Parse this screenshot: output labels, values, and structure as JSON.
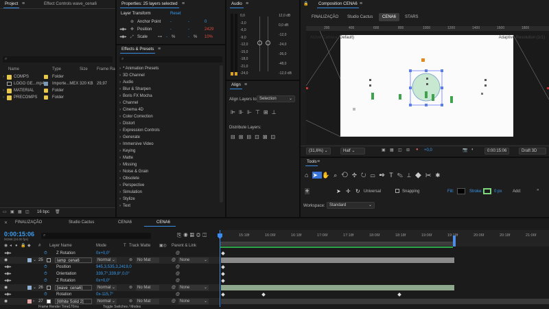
{
  "project": {
    "tabs": [
      "Project",
      "Effect Controls wave_cena6"
    ],
    "search_placeholder": "",
    "columns": [
      "Name",
      "Type",
      "Size",
      "Frame Ra..."
    ],
    "items": [
      {
        "name": "COMPS",
        "type": "Folder",
        "size": "",
        "fps": "",
        "kind": "folder"
      },
      {
        "name": "LOGO GE...mp4",
        "type": "Importe...MEX",
        "size": "320 KB",
        "fps": "29,97",
        "kind": "file"
      },
      {
        "name": "MATERIAL",
        "type": "Folder",
        "size": "",
        "fps": "",
        "kind": "folder"
      },
      {
        "name": "PRECOMPS",
        "type": "Folder",
        "size": "",
        "fps": "",
        "kind": "folder"
      }
    ],
    "bpc": "16 bpc"
  },
  "properties": {
    "title": "Properties: 25 layers selected",
    "section": "Layer Transform",
    "reset": "Reset",
    "rows": [
      {
        "label": "Anchor Point",
        "v1": "-",
        "v2": "-",
        "v3": "0"
      },
      {
        "label": "Position",
        "v1": "-",
        "v2": "-",
        "v3": "2429"
      },
      {
        "label": "Scale",
        "v1": "-",
        "v2": "%",
        "v3": "-",
        "v4": "%",
        "v5": "10%"
      }
    ]
  },
  "audio": {
    "title": "Audio",
    "left_scale": [
      "0,0",
      "-3,0",
      "-6,0",
      "-9,0",
      "-12,0",
      "-15,0",
      "-18,0",
      "-21,0",
      "-24,0"
    ],
    "right_scale": [
      "12,0 dB",
      "0,0 dB",
      "-12,0",
      "-24,0",
      "-36,0",
      "-48,0",
      "-12,0 dB"
    ],
    "right_scale_bottom": "-12,0 dB"
  },
  "effects": {
    "title": "Effects & Presets",
    "search_placeholder": "",
    "items": [
      "* Animation Presets",
      "3D Channel",
      "Audio",
      "Blur & Sharpen",
      "Boris FX Mocha",
      "Channel",
      "Cinema 4D",
      "Color Correction",
      "Distort",
      "Expression Controls",
      "Generate",
      "Immersive Video",
      "Keying",
      "Matte",
      "Missing",
      "Noise & Grain",
      "Obsolete",
      "Perspective",
      "Simulation",
      "Stylize",
      "Text"
    ]
  },
  "align": {
    "title": "Align",
    "align_to_label": "Align Layers to:",
    "align_to_value": "Selection",
    "distribute_label": "Distribute Layers:"
  },
  "composition": {
    "title": "Composition CENA6",
    "tabs": [
      "FINALIZAÇÃO",
      "Studio Cactus",
      "CENA6",
      "STARS"
    ],
    "active_tab": 2,
    "camera_label": "Active Camera (Default)",
    "resolution_label": "Adaptive Resolution (1/1)",
    "ruler": [
      "200",
      "400",
      "600",
      "800",
      "1000",
      "1200",
      "1400",
      "1600",
      "1800"
    ],
    "zoom": "(31,6%)",
    "quality": "Half",
    "exposure": "+0,0",
    "time": "0:00:15:06",
    "renderer": "Draft 3D"
  },
  "tools": {
    "title": "Tools",
    "universal": "Universal",
    "snapping": "Snapping",
    "fill": "Fill:",
    "stroke": "Stroke:",
    "stroke_px": "0 px",
    "add": "Add:",
    "workspace_label": "Workspace:",
    "workspace_value": "Standard"
  },
  "timeline": {
    "tabs": [
      "FINALIZAÇÃO",
      "Studio Cactus",
      "CENA6",
      "CENA6"
    ],
    "active_tab": 3,
    "timecode": "0:00:15:06",
    "timecode_sub": "00366 (24.00 fps)",
    "search_placeholder": "",
    "headers": {
      "layer_name": "Layer Name",
      "mode": "Mode",
      "t": "T",
      "track_matte": "Track Matte",
      "parent": "Parent & Link"
    },
    "ruler": [
      "15:18f",
      "16:06f",
      "16:18f",
      "17:06f",
      "17:18f",
      "18:06f",
      "18:18f",
      "19:06f",
      "19:18f",
      "20:06f",
      "20:18f",
      "21:06f"
    ],
    "rows": [
      {
        "type": "prop",
        "name": "Z Rotation",
        "value": "0x+0,0°"
      },
      {
        "type": "layer",
        "num": "25",
        "name": "lamp_cena6",
        "mode": "Normal",
        "matte": "No Mat",
        "parent": "None"
      },
      {
        "type": "prop",
        "name": "Position",
        "value": "945,3,535,3,2419,0"
      },
      {
        "type": "prop",
        "name": "Orientation",
        "value": "339,7°,339,8°,0,0°"
      },
      {
        "type": "prop",
        "name": "Z Rotation",
        "value": "0x+0,0°"
      },
      {
        "type": "layer",
        "num": "26",
        "name": "[wave_cena6]",
        "mode": "Normal",
        "matte": "No Mat",
        "parent": "None"
      },
      {
        "type": "prop",
        "name": "Rotation",
        "value": "0x-115,7°"
      },
      {
        "type": "layer",
        "num": "27",
        "name": "[White Solid 2]",
        "mode": "Normal",
        "matte": "No Mat",
        "parent": "None"
      }
    ],
    "footer": {
      "render": "Frame Render Time",
      "render_val": "170ms",
      "toggle": "Toggle Switches / Modes"
    }
  },
  "colors": {
    "accent": "#3b9cf0",
    "keyframe_red": "#e24b3c",
    "folder": "#e8c84c",
    "layer_green": "#8da88c",
    "layer_gray": "#8a8a8a"
  }
}
